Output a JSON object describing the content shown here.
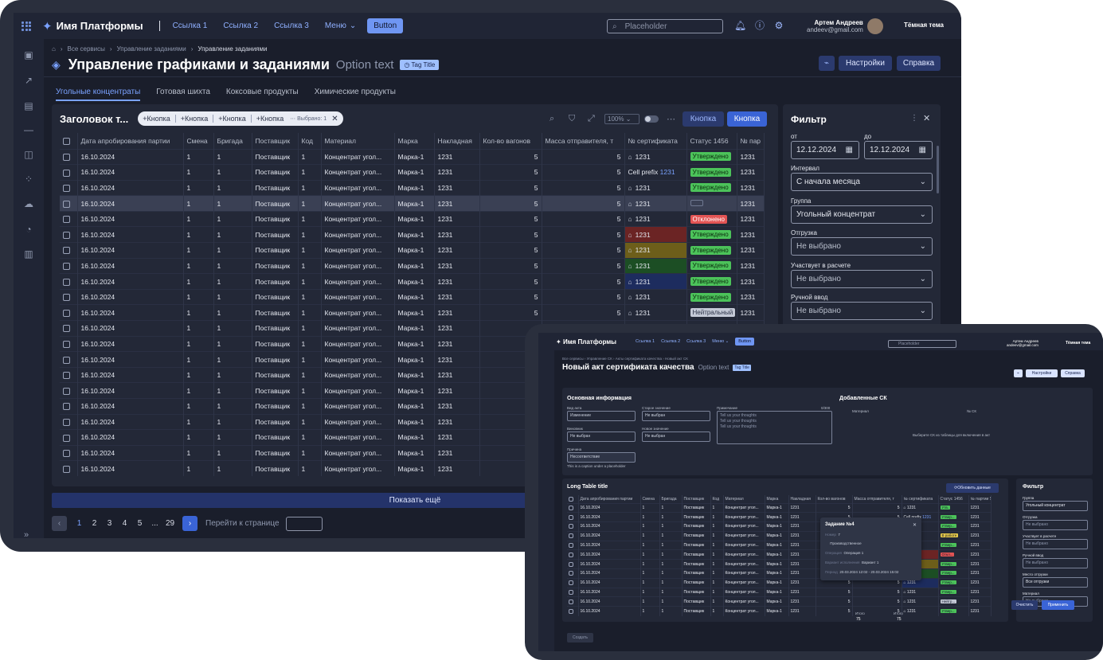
{
  "main": {
    "app": {
      "name": "Имя Платформы",
      "links": [
        "Ссылка 1",
        "Ссылка 2",
        "Ссылка 3"
      ],
      "menu": "Меню",
      "button": "Button",
      "search_placeholder": "Placeholder",
      "user_name": "Артем Андреев",
      "user_email": "andeev@gmail.com",
      "theme": "Тёмная тема"
    },
    "breadcrumbs": [
      "Все сервисы",
      "Управление заданиями",
      "Управление заданиями"
    ],
    "title": "Управление графиками и заданиями",
    "option_text": "Option text",
    "tag": "Tag Title",
    "header_buttons": {
      "settings": "Настройки",
      "help": "Справка"
    },
    "tabs": [
      "Угольные концентраты",
      "Готовая шихта",
      "Коксовые продукты",
      "Химические продукты"
    ],
    "active_tab": 0,
    "table": {
      "title": "Заголовок т...",
      "chips": [
        "Кнопка",
        "Кнопка",
        "Кнопка",
        "Кнопка"
      ],
      "selected": "Выбрано: 1",
      "zoom": "100%",
      "btn_secondary": "Кнопка",
      "btn_primary": "Кнопка",
      "columns": [
        "Дата апробирования партии",
        "Смена",
        "Бригада",
        "Поставщик",
        "Код",
        "Материал",
        "Марка",
        "Накладная",
        "Кол-во вагонов",
        "Масса отправителя, т",
        "№ сертификата",
        "Статус 1456",
        "№ пар"
      ],
      "rows": [
        {
          "date": "16.10.2024",
          "smena": "1",
          "brigada": "1",
          "post": "Поставщик",
          "kod": "1",
          "mat": "Концентрат угол...",
          "marka": "Марка-1",
          "nakl": "1231",
          "vag": "5",
          "massa": "5",
          "cert": "1231",
          "cert_style": "flag",
          "status": "Утверждено",
          "status_kind": "ok",
          "par": "1231"
        },
        {
          "date": "16.10.2024",
          "smena": "1",
          "brigada": "1",
          "post": "Поставщик",
          "kod": "1",
          "mat": "Концентрат угол...",
          "marka": "Марка-1",
          "nakl": "1231",
          "vag": "5",
          "massa": "5",
          "cert": "1231",
          "cert_style": "prefix",
          "cert_prefix": "Cell prefix",
          "status": "Утверждено",
          "status_kind": "ok",
          "par": "1231"
        },
        {
          "date": "16.10.2024",
          "smena": "1",
          "brigada": "1",
          "post": "Поставщик",
          "kod": "1",
          "mat": "Концентрат угол...",
          "marka": "Марка-1",
          "nakl": "1231",
          "vag": "5",
          "massa": "5",
          "cert": "1231",
          "cert_style": "plain",
          "status": "Утверждено",
          "status_kind": "ok",
          "par": "1231"
        },
        {
          "date": "16.10.2024",
          "smena": "1",
          "brigada": "1",
          "post": "Поставщик",
          "kod": "1",
          "mat": "Концентрат угол...",
          "marka": "Марка-1",
          "nakl": "1231",
          "vag": "5",
          "massa": "5",
          "cert": "1231",
          "cert_style": "plain",
          "status": "",
          "status_kind": "empty",
          "par": "1231",
          "highlight": true
        },
        {
          "date": "16.10.2024",
          "smena": "1",
          "brigada": "1",
          "post": "Поставщик",
          "kod": "1",
          "mat": "Концентрат угол...",
          "marka": "Марка-1",
          "nakl": "1231",
          "vag": "5",
          "massa": "5",
          "cert": "1231",
          "cert_style": "plain",
          "status": "Отклонено",
          "status_kind": "no",
          "par": "1231"
        },
        {
          "date": "16.10.2024",
          "smena": "1",
          "brigada": "1",
          "post": "Поставщик",
          "kod": "1",
          "mat": "Концентрат угол...",
          "marka": "Марка-1",
          "nakl": "1231",
          "vag": "5",
          "massa": "5",
          "cert": "1231",
          "cert_style": "red",
          "status": "Утверждено",
          "status_kind": "ok",
          "par": "1231"
        },
        {
          "date": "16.10.2024",
          "smena": "1",
          "brigada": "1",
          "post": "Поставщик",
          "kod": "1",
          "mat": "Концентрат угол...",
          "marka": "Марка-1",
          "nakl": "1231",
          "vag": "5",
          "massa": "5",
          "cert": "1231",
          "cert_style": "yellow",
          "status": "Утверждено",
          "status_kind": "ok",
          "par": "1231"
        },
        {
          "date": "16.10.2024",
          "smena": "1",
          "brigada": "1",
          "post": "Поставщик",
          "kod": "1",
          "mat": "Концентрат угол...",
          "marka": "Марка-1",
          "nakl": "1231",
          "vag": "5",
          "massa": "5",
          "cert": "1231",
          "cert_style": "green",
          "status": "Утверждено",
          "status_kind": "ok",
          "par": "1231"
        },
        {
          "date": "16.10.2024",
          "smena": "1",
          "brigada": "1",
          "post": "Поставщик",
          "kod": "1",
          "mat": "Концентрат угол...",
          "marka": "Марка-1",
          "nakl": "1231",
          "vag": "5",
          "massa": "5",
          "cert": "1231",
          "cert_style": "blue",
          "status": "Утверждено",
          "status_kind": "ok",
          "par": "1231"
        },
        {
          "date": "16.10.2024",
          "smena": "1",
          "brigada": "1",
          "post": "Поставщик",
          "kod": "1",
          "mat": "Концентрат угол...",
          "marka": "Марка-1",
          "nakl": "1231",
          "vag": "5",
          "massa": "5",
          "cert": "1231",
          "cert_style": "plain",
          "status": "Утверждено",
          "status_kind": "ok",
          "par": "1231"
        },
        {
          "date": "16.10.2024",
          "smena": "1",
          "brigada": "1",
          "post": "Поставщик",
          "kod": "1",
          "mat": "Концентрат угол...",
          "marka": "Марка-1",
          "nakl": "1231",
          "vag": "5",
          "massa": "5",
          "cert": "1231",
          "cert_style": "plain",
          "status": "Нейтральный",
          "status_kind": "neu",
          "par": "1231"
        },
        {
          "date": "16.10.2024",
          "smena": "1",
          "brigada": "1",
          "post": "Поставщик",
          "kod": "1",
          "mat": "Концентрат угол...",
          "marka": "Марка-1",
          "nakl": "1231",
          "vag": "",
          "massa": "",
          "cert": "",
          "cert_style": "none",
          "status": "",
          "status_kind": "none",
          "par": ""
        },
        {
          "date": "16.10.2024",
          "smena": "1",
          "brigada": "1",
          "post": "Поставщик",
          "kod": "1",
          "mat": "Концентрат угол...",
          "marka": "Марка-1",
          "nakl": "1231",
          "vag": "",
          "massa": "",
          "cert": "",
          "cert_style": "none",
          "status": "",
          "status_kind": "none",
          "par": ""
        },
        {
          "date": "16.10.2024",
          "smena": "1",
          "brigada": "1",
          "post": "Поставщик",
          "kod": "1",
          "mat": "Концентрат угол...",
          "marka": "Марка-1",
          "nakl": "1231",
          "vag": "",
          "massa": "",
          "cert": "",
          "cert_style": "none",
          "status": "",
          "status_kind": "none",
          "par": ""
        },
        {
          "date": "16.10.2024",
          "smena": "1",
          "brigada": "1",
          "post": "Поставщик",
          "kod": "1",
          "mat": "Концентрат угол...",
          "marka": "Марка-1",
          "nakl": "1231",
          "vag": "",
          "massa": "",
          "cert": "",
          "cert_style": "none",
          "status": "",
          "status_kind": "none",
          "par": ""
        },
        {
          "date": "16.10.2024",
          "smena": "1",
          "brigada": "1",
          "post": "Поставщик",
          "kod": "1",
          "mat": "Концентрат угол...",
          "marka": "Марка-1",
          "nakl": "1231",
          "vag": "",
          "massa": "",
          "cert": "",
          "cert_style": "none",
          "status": "",
          "status_kind": "none",
          "par": ""
        },
        {
          "date": "16.10.2024",
          "smena": "1",
          "brigada": "1",
          "post": "Поставщик",
          "kod": "1",
          "mat": "Концентрат угол...",
          "marka": "Марка-1",
          "nakl": "1231",
          "vag": "",
          "massa": "",
          "cert": "",
          "cert_style": "none",
          "status": "",
          "status_kind": "none",
          "par": ""
        },
        {
          "date": "16.10.2024",
          "smena": "1",
          "brigada": "1",
          "post": "Поставщик",
          "kod": "1",
          "mat": "Концентрат угол...",
          "marka": "Марка-1",
          "nakl": "1231",
          "vag": "",
          "massa": "",
          "cert": "",
          "cert_style": "none",
          "status": "",
          "status_kind": "none",
          "par": ""
        },
        {
          "date": "16.10.2024",
          "smena": "1",
          "brigada": "1",
          "post": "Поставщик",
          "kod": "1",
          "mat": "Концентрат угол...",
          "marka": "Марка-1",
          "nakl": "1231",
          "vag": "",
          "massa": "",
          "cert": "",
          "cert_style": "none",
          "status": "",
          "status_kind": "none",
          "par": ""
        },
        {
          "date": "16.10.2024",
          "smena": "1",
          "brigada": "1",
          "post": "Поставщик",
          "kod": "1",
          "mat": "Концентрат угол...",
          "marka": "Марка-1",
          "nakl": "1231",
          "vag": "",
          "massa": "",
          "cert": "",
          "cert_style": "none",
          "status": "",
          "status_kind": "none",
          "par": ""
        },
        {
          "date": "16.10.2024",
          "smena": "1",
          "brigada": "1",
          "post": "Поставщик",
          "kod": "1",
          "mat": "Концентрат угол...",
          "marka": "Марка-1",
          "nakl": "1231",
          "vag": "",
          "massa": "",
          "cert": "",
          "cert_style": "none",
          "status": "",
          "status_kind": "none",
          "par": ""
        }
      ]
    },
    "show_more": "Показать ещё",
    "pagination": {
      "pages": [
        "1",
        "2",
        "3",
        "4",
        "5",
        "...",
        "29"
      ],
      "active": 0,
      "goto": "Перейти к странице"
    },
    "filter": {
      "title": "Фильтр",
      "from_label": "от",
      "from_value": "12.12.2024",
      "to_label": "до",
      "to_value": "12.12.2024",
      "fields": [
        {
          "label": "Интервал",
          "value": "С начала месяца",
          "placeholder": false
        },
        {
          "label": "Группа",
          "value": "Угольный концентрат",
          "placeholder": false
        },
        {
          "label": "Отгрузка",
          "value": "Не выбрано",
          "placeholder": true
        },
        {
          "label": "Участвует в расчете",
          "value": "Не выбрано",
          "placeholder": true
        },
        {
          "label": "Ручной ввод",
          "value": "Не выбрано",
          "placeholder": true
        }
      ]
    }
  },
  "second": {
    "app_name": "Имя Платформы",
    "links": [
      "Ссылка 1",
      "Ссылка 2",
      "Ссылка 3",
      "Меню"
    ],
    "button": "Button",
    "search_placeholder": "Placeholder",
    "user_name": "Артем Андреев",
    "user_email": "andeev@gmail.com",
    "theme": "Тёмная тема",
    "breadcrumbs": "Все сервисы  ›  Управление СК  ›  Акты сертификата качества  ›  Новый акт СК",
    "title": "Новый акт сертификата качества",
    "option_text": "Option text",
    "tag": "Tag Title",
    "header_buttons": [
      "Настройки",
      "Справка"
    ],
    "basic_info": "Основная информация",
    "fields": {
      "vid_akta_label": "Вид акта",
      "vid_akta_value": "Изменение",
      "old_label": "Старое значение",
      "old_value": "Не выбран",
      "vinovnik_label": "Виновник",
      "vinovnik_value": "Не выбран",
      "new_label": "Новое значение",
      "new_value": "Не выбран",
      "prichina_label": "Причина",
      "prichina_value": "Несоответствие",
      "caption": "This is a caption under a placeholder",
      "note_label": "Примечание",
      "note_count": "0/300",
      "note_lines": [
        "Tell us your thoughts",
        "Tell us your thoughts",
        "Tell us your thoughts"
      ]
    },
    "added_sk": "Добавленные СК",
    "added_cols": [
      "Материал",
      "№ СК"
    ],
    "added_hint": "Выберите СК из таблицы для включения в акт",
    "long_table_title": "Long Table title",
    "refresh": "Обновить данные",
    "cols": [
      "Дата апробирования партии",
      "Смена",
      "Бригада",
      "Поставщик",
      "Код",
      "Материал",
      "Марка",
      "Накладная",
      "Кол-во вагонов",
      "Масса отправителя, т",
      "№ сертификата",
      "Статус 1456",
      "№ партии SA"
    ],
    "row": {
      "date": "16.10.2024",
      "n": "1",
      "post": "Поставщик",
      "mat": "Концентрат угол...",
      "marka": "Марка-1",
      "nakl": "1231",
      "v": "5",
      "cert": "1231",
      "cert_prefix": "Cell prefix"
    },
    "statuses": [
      "Утв.",
      "Утвер...",
      "Утвер...",
      "В работе",
      "Утвер...",
      "Откл...",
      "Утвер...",
      "Утвер...",
      "Утвер...",
      "Утвер...",
      "Нейтр...",
      "Утвер..."
    ],
    "totals": {
      "sum_label": "Итого",
      "sum_a": "75",
      "sum_b": "75"
    },
    "popup": {
      "title": "Задание №4",
      "rows": [
        {
          "k": "Номер",
          "v": "7"
        },
        {
          "k": "",
          "v": "Производственное"
        },
        {
          "k": "Операция",
          "v": "Операция 1"
        },
        {
          "k": "Вариант исполнения",
          "v": "Вариант 1"
        },
        {
          "k": "Период",
          "v": "20.03.2024  12:02 - 20.03.2024  15:02"
        }
      ]
    },
    "filter": {
      "title": "Фильтр",
      "fields": [
        {
          "label": "Группа",
          "value": "Угольный концентрат",
          "placeholder": false
        },
        {
          "label": "Отгрузка",
          "value": "Не выбрано",
          "placeholder": true
        },
        {
          "label": "Участвует в расчете",
          "value": "Не выбрано",
          "placeholder": true
        },
        {
          "label": "Ручной ввод",
          "value": "Не выбрано",
          "placeholder": true
        },
        {
          "label": "Место отгрузки",
          "value": "Все отгрузки",
          "placeholder": false
        },
        {
          "label": "Материал",
          "value": "Не выбрано",
          "placeholder": true
        }
      ],
      "clear": "Очистить",
      "apply": "Применить"
    },
    "create": "Создать"
  }
}
